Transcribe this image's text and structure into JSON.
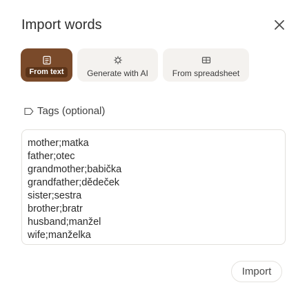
{
  "dialog": {
    "title": "Import words",
    "close_icon": "close-icon"
  },
  "tabs": [
    {
      "label": "From text",
      "icon": "document-icon",
      "active": true
    },
    {
      "label": "Generate with AI",
      "icon": "sparkle-gear-icon",
      "active": false
    },
    {
      "label": "From spreadsheet",
      "icon": "table-icon",
      "active": false
    }
  ],
  "tags": {
    "label": "Tags (optional)",
    "icon": "tag-icon"
  },
  "words": [
    "mother;matka",
    "father;otec",
    "grandmother;babička",
    "grandfather;dědeček",
    "sister;sestra",
    "brother;bratr",
    "husband;manžel",
    "wife;manželka"
  ],
  "actions": {
    "import_label": "Import"
  },
  "colors": {
    "active_tab": "#7a4a2a",
    "active_tab_label": "#5b3318",
    "tab_bg": "#f4f2ef"
  }
}
